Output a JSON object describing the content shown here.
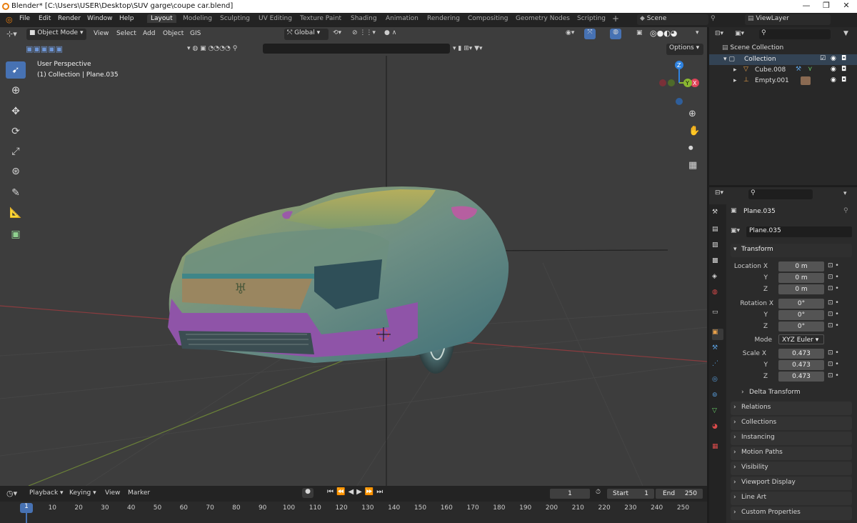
{
  "window": {
    "title": "Blender* [C:\\Users\\USER\\Desktop\\SUV  garge\\coupe car.blend]"
  },
  "menu": [
    "File",
    "Edit",
    "Render",
    "Window",
    "Help"
  ],
  "workspaces": [
    "Layout",
    "Modeling",
    "Sculpting",
    "UV Editing",
    "Texture Paint",
    "Shading",
    "Animation",
    "Rendering",
    "Compositing",
    "Geometry Nodes",
    "Scripting",
    "+"
  ],
  "scene": {
    "scene_name": "Scene",
    "view_layer": "ViewLayer"
  },
  "viewport": {
    "mode": "Object Mode",
    "menus": [
      "View",
      "Select",
      "Add",
      "Object",
      "GIS"
    ],
    "orientation": "Global",
    "options_label": "Options",
    "overlay_line1": "User Perspective",
    "overlay_line2": "(1) Collection | Plane.035",
    "gizmo": {
      "z": "Z",
      "y": "Y",
      "x": "X"
    }
  },
  "outliner": {
    "scene_collection": "Scene Collection",
    "items": [
      {
        "label": "Collection"
      },
      {
        "label": "Cube.008"
      },
      {
        "label": "Empty.001"
      }
    ]
  },
  "properties": {
    "object_name": "Plane.035",
    "data_name": "Plane.035",
    "transform_label": "Transform",
    "location_label": "Location X",
    "rotation_label": "Rotation X",
    "scale_label": "Scale X",
    "axis_y": "Y",
    "axis_z": "Z",
    "location": [
      "0 m",
      "0 m",
      "0 m"
    ],
    "rotation": [
      "0°",
      "0°",
      "0°"
    ],
    "mode_label": "Mode",
    "mode_value": "XYZ Euler",
    "scale": [
      "0.473",
      "0.473",
      "0.473"
    ],
    "delta_transform": "Delta Transform",
    "panels": [
      "Relations",
      "Collections",
      "Instancing",
      "Motion Paths",
      "Visibility",
      "Viewport Display",
      "Line Art",
      "Custom Properties"
    ]
  },
  "timeline": {
    "menus": [
      "Playback",
      "Keying",
      "View",
      "Marker"
    ],
    "current_frame": "1",
    "start_label": "Start",
    "start": "1",
    "end_label": "End",
    "end": "250",
    "playhead": "1",
    "ticks": [
      "10",
      "20",
      "30",
      "40",
      "50",
      "60",
      "70",
      "80",
      "90",
      "100",
      "110",
      "120",
      "130",
      "140",
      "150",
      "160",
      "170",
      "180",
      "190",
      "200",
      "210",
      "220",
      "230",
      "240",
      "250"
    ]
  },
  "colors": {
    "accent": "#4772b3",
    "x_axis": "#e0445a",
    "y_axis": "#8ab831",
    "z_axis": "#2f83e0",
    "viewport_bg": "#3d3d3d"
  }
}
